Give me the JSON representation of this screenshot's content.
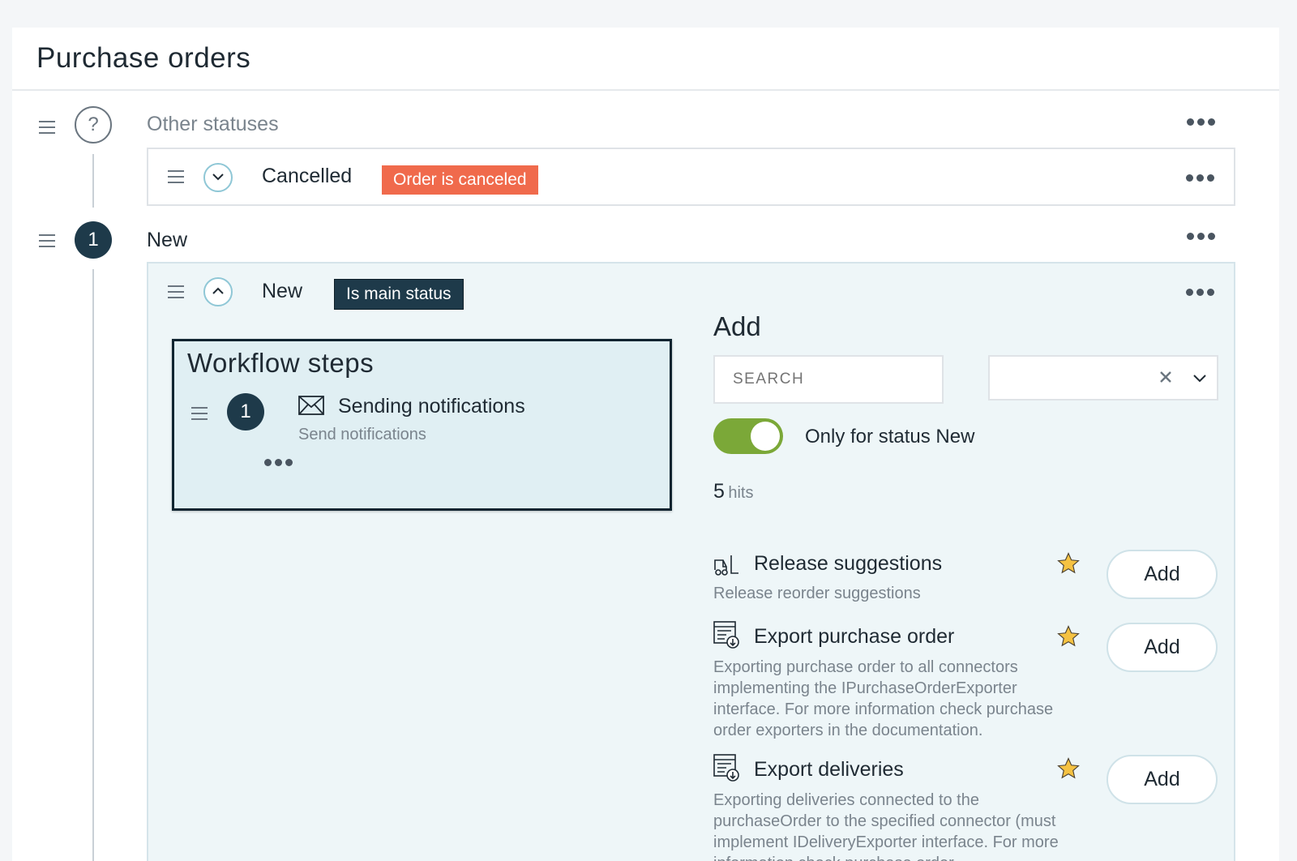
{
  "page": {
    "title": "Purchase orders"
  },
  "groups": {
    "other": {
      "label": "Other statuses",
      "marker": "?"
    },
    "new": {
      "label": "New",
      "marker": "1"
    }
  },
  "statuses": {
    "cancelled": {
      "name": "Cancelled",
      "badge": "Order is canceled",
      "badge_color": "#f06a4c"
    },
    "new": {
      "name": "New",
      "badge": "Is main status",
      "badge_color": "#1e3a4a"
    }
  },
  "workflow": {
    "title": "Workflow steps",
    "steps": [
      {
        "number": "1",
        "title": "Sending notifications",
        "subtitle": "Send notifications",
        "icon": "envelope-icon"
      }
    ]
  },
  "add_panel": {
    "title": "Add",
    "search_placeholder": "SEARCH",
    "toggle_label": "Only for status New",
    "toggle_on": true,
    "toggle_color": "#7ba838",
    "hits_count": "5",
    "hits_label": "hits",
    "items": [
      {
        "title": "Release suggestions",
        "description": "Release reorder suggestions",
        "icon": "forklift-icon",
        "button": "Add"
      },
      {
        "title": "Export purchase order",
        "description": "Exporting purchase order to all connectors implementing the IPurchaseOrderExporter interface. For more information check purchase order exporters in the documentation.",
        "icon": "export-icon",
        "button": "Add"
      },
      {
        "title": "Export deliveries",
        "description": "Exporting deliveries connected to the purchaseOrder to the specified connector (must implement IDeliveryExporter interface. For more information check purchase order",
        "icon": "export-icon",
        "button": "Add"
      }
    ]
  },
  "colors": {
    "accent_dark": "#1e3a4a",
    "star": "#f5c242"
  }
}
